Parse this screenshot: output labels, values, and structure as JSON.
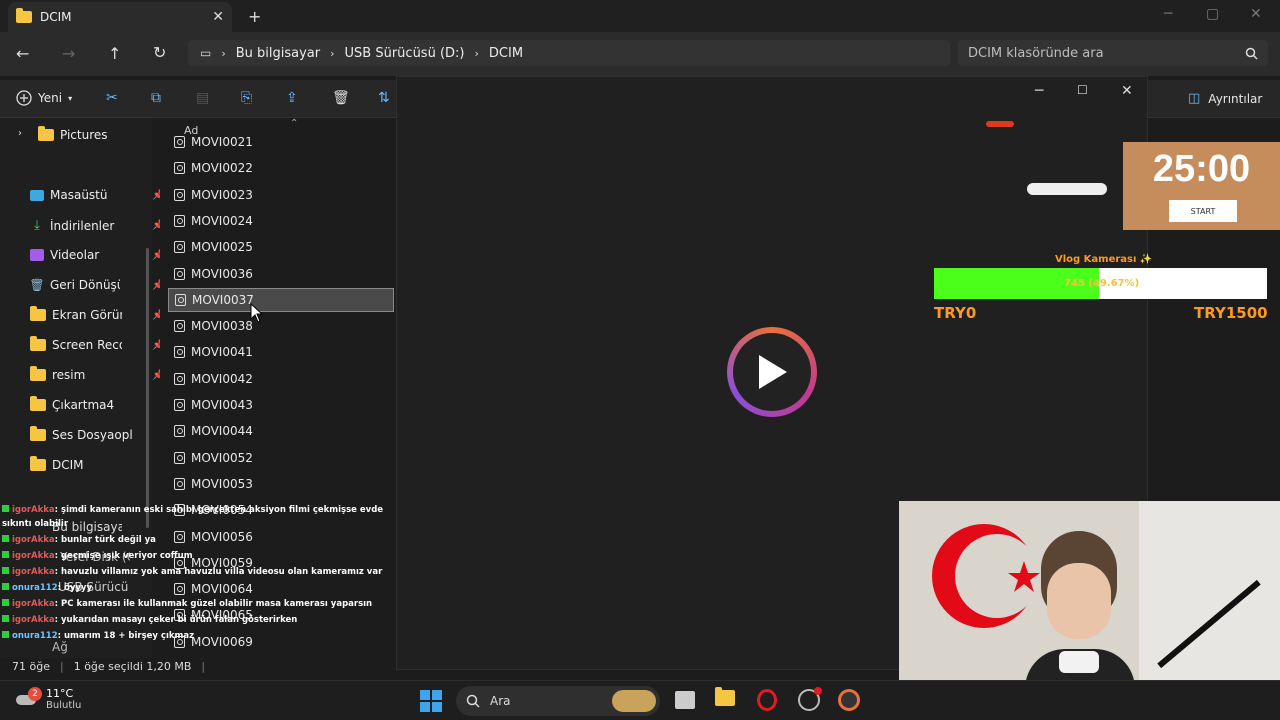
{
  "window": {
    "tab_title": "DCIM"
  },
  "nav_buttons": {
    "back": "←",
    "forward": "→",
    "up": "↑",
    "refresh": "↻"
  },
  "breadcrumbs": [
    "Bu bilgisayar",
    "USB Sürücüsü (D:)",
    "DCIM"
  ],
  "search": {
    "placeholder": "DCIM klasöründe ara"
  },
  "toolbar": {
    "new_label": "Yeni",
    "details_label": "Ayrıntılar"
  },
  "nav_pane": {
    "items": [
      {
        "label": "Pictures"
      },
      {
        "label": "Masaüstü"
      },
      {
        "label": "İndirilenler"
      },
      {
        "label": "Videolar"
      },
      {
        "label": "Geri Dönüşüm"
      },
      {
        "label": "Ekran Görüntü"
      },
      {
        "label": "Screen Recorc"
      },
      {
        "label": "resim"
      },
      {
        "label": "Çıkartma4"
      },
      {
        "label": "Ses Dosyaopları"
      },
      {
        "label": "DCIM"
      },
      {
        "label": "Bu bilgisayar"
      },
      {
        "label": "Yerel Disk (C:)"
      },
      {
        "label": "USB Sürücüsü (D"
      },
      {
        "label": "Ağ"
      }
    ]
  },
  "file_list": {
    "column_header": "Ad",
    "files": [
      "MOVI0021",
      "MOVI0022",
      "MOVI0023",
      "MOVI0024",
      "MOVI0025",
      "MOVI0036",
      "MOVI0037",
      "MOVI0038",
      "MOVI0041",
      "MOVI0042",
      "MOVI0043",
      "MOVI0044",
      "MOVI0052",
      "MOVI0053",
      "MOVI0054",
      "MOVI0056",
      "MOVI0059",
      "MOVI0064",
      "MOVI0065",
      "MOVI0069"
    ],
    "selected": "MOVI0037"
  },
  "status_bar": {
    "count": "71 öğe",
    "selection": "1 öğe seçildi 1,20 MB"
  },
  "timer": {
    "time": "25:00",
    "button": "START"
  },
  "goal": {
    "title": "Vlog Kamerası ✨",
    "progress_text": "745 (49.67%)",
    "progress": 0.4967,
    "min_label": "TRY0",
    "max_label": "TRY1500"
  },
  "chat": [
    {
      "user": "igorAkka",
      "msg": ": şimdi kameranın eski sahibi gerçekten aksiyon filmi çekmişse evde",
      "cont": "sıkıntı olabilir"
    },
    {
      "user": "igorAkka",
      "msg": ": bunlar türk değil ya"
    },
    {
      "user": "igorAkka",
      "msg": ": geçmişe ışık veriyor coffum"
    },
    {
      "user": "igorAkka",
      "msg": ": havuzlu villamız yok ama havuzlu villa videosu olan kameramız var"
    },
    {
      "user": "onura112",
      "msg": ": öyyyy"
    },
    {
      "user": "igorAkka",
      "msg": ": PC kamerası ile kullanmak güzel olabilir masa kamerası yaparsın"
    },
    {
      "user": "igorAkka",
      "msg": ": yukarıdan masayı çeker bi ürün falan gösterirken"
    },
    {
      "user": "onura112",
      "msg": ": umarım 18 + birşey çıkmaz"
    }
  ],
  "taskbar": {
    "weather_temp": "11°C",
    "weather_desc": "Bulutlu",
    "search_label": "Ara",
    "badge": "2"
  },
  "colors": {
    "accent": "#4cc2ff",
    "goal_fill": "#4cff1a",
    "timer_bg": "#c58c5c"
  }
}
